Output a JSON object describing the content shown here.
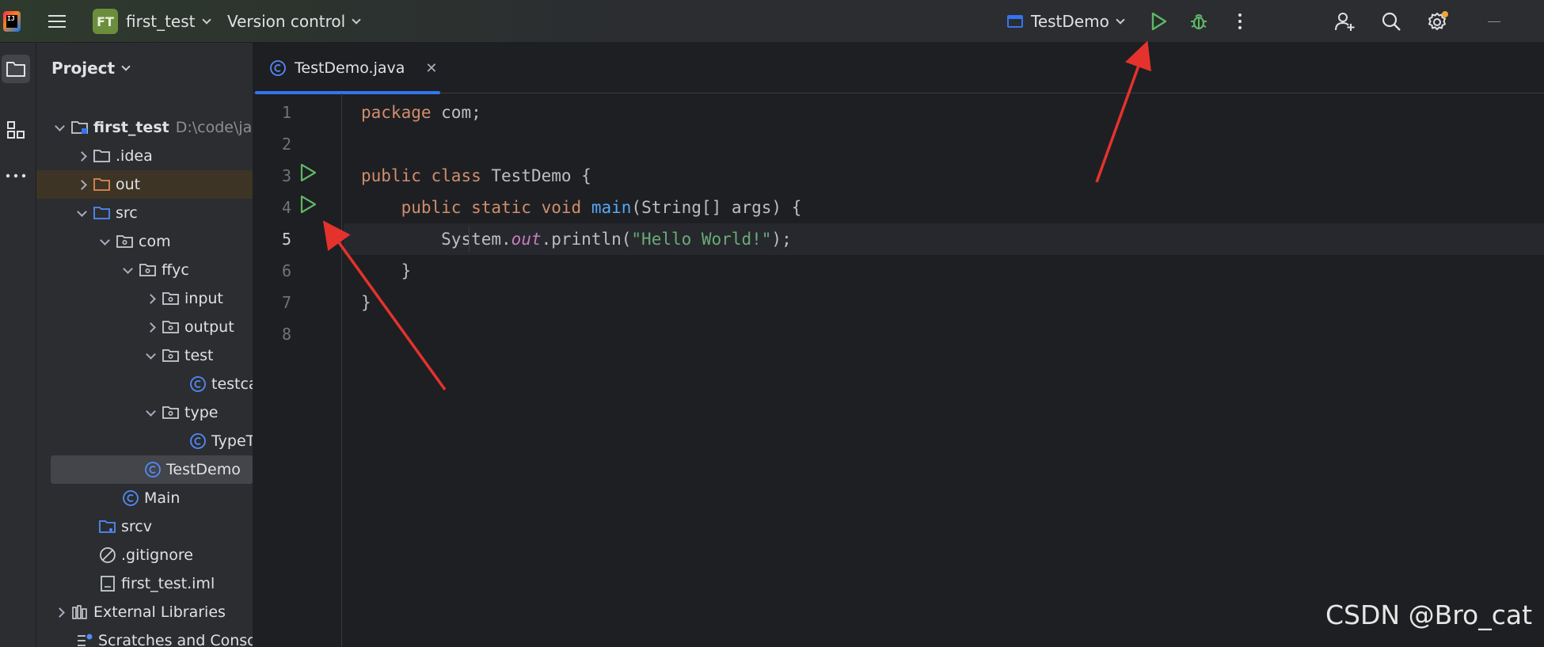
{
  "titlebar": {
    "project_badge": "FT",
    "project_name": "first_test",
    "vcs_label": "Version control",
    "run_config": "TestDemo"
  },
  "project_panel": {
    "title": "Project",
    "tree": [
      {
        "label": "first_test",
        "hint": "D:\\code\\ja"
      },
      {
        "label": ".idea"
      },
      {
        "label": "out"
      },
      {
        "label": "src"
      },
      {
        "label": "com"
      },
      {
        "label": "ffyc"
      },
      {
        "label": "input"
      },
      {
        "label": "output"
      },
      {
        "label": "test"
      },
      {
        "label": "testca"
      },
      {
        "label": "type"
      },
      {
        "label": "TypeT"
      },
      {
        "label": "TestDemo"
      },
      {
        "label": "Main"
      },
      {
        "label": "srcv"
      },
      {
        "label": ".gitignore"
      },
      {
        "label": "first_test.iml"
      },
      {
        "label": "External Libraries"
      },
      {
        "label": "Scratches and Conso"
      }
    ]
  },
  "editor": {
    "tab_label": "TestDemo.java",
    "line_numbers": [
      "1",
      "2",
      "3",
      "4",
      "5",
      "6",
      "7",
      "8"
    ],
    "lines": {
      "l1": {
        "kw": "package",
        "rest": " com;"
      },
      "l3": {
        "kw1": "public",
        "kw2": "class",
        "rest": " TestDemo {"
      },
      "l4": {
        "kw1": "public",
        "kw2": "static",
        "kw3": "void",
        "fn": "main",
        "rest": "(String[] args) {"
      },
      "l5": {
        "pre": "System.",
        "fld": "out",
        "mid": ".println(",
        "str": "\"Hello World!\"",
        "post": ");"
      },
      "l6": {
        "text": "}"
      },
      "l7": {
        "text": "}"
      }
    }
  },
  "watermark": "CSDN @Bro_cat",
  "colors": {
    "background": "#1e1f22",
    "panel": "#2b2d30",
    "accent": "#3574f0",
    "run_green": "#5fb865",
    "arrow_red": "#e5322d"
  }
}
